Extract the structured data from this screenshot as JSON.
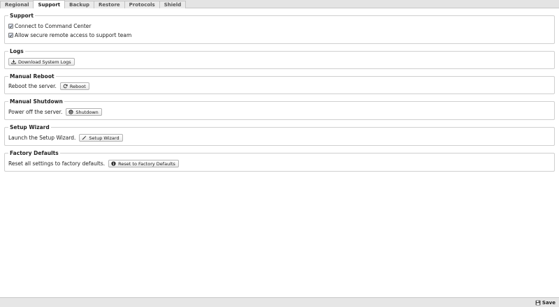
{
  "tabs": [
    {
      "label": "Regional",
      "active": false
    },
    {
      "label": "Support",
      "active": true
    },
    {
      "label": "Backup",
      "active": false
    },
    {
      "label": "Restore",
      "active": false
    },
    {
      "label": "Protocols",
      "active": false
    },
    {
      "label": "Shield",
      "active": false
    }
  ],
  "support": {
    "title": "Support",
    "connect_label": "Connect to Command Center",
    "connect_checked": true,
    "remote_label": "Allow secure remote access to support team",
    "remote_checked": true
  },
  "logs": {
    "title": "Logs",
    "download_button": "Download System Logs",
    "download_icon": "download-icon"
  },
  "reboot": {
    "title": "Manual Reboot",
    "description": "Reboot the server.",
    "button": "Reboot",
    "icon": "refresh-icon"
  },
  "shutdown": {
    "title": "Manual Shutdown",
    "description": "Power off the server.",
    "button": "Shutdown",
    "icon": "power-icon"
  },
  "wizard": {
    "title": "Setup Wizard",
    "description": "Launch the Setup Wizard.",
    "button": "Setup Wizard",
    "icon": "magic-wand-icon"
  },
  "factory": {
    "title": "Factory Defaults",
    "description": "Reset all settings to factory defaults.",
    "button": "Reset to Factory Defaults",
    "icon": "info-icon"
  },
  "footer": {
    "save_label": "Save",
    "save_icon": "floppy-disk-icon"
  },
  "colors": {
    "tabbar_bg": "#e4e4e4",
    "panel_border": "#cfcfcf",
    "footer_bg": "#e6e6e6"
  }
}
